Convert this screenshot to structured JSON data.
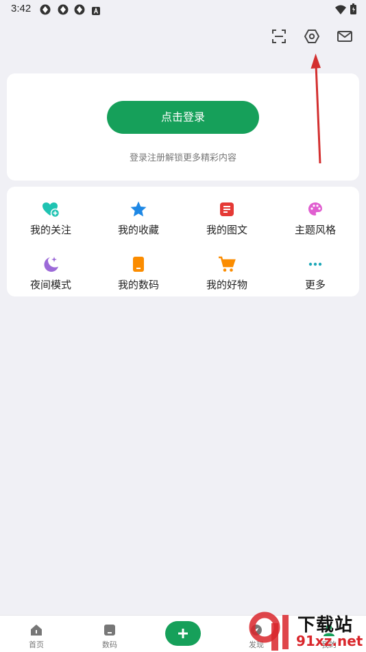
{
  "status": {
    "time": "3:42"
  },
  "login": {
    "button_label": "点击登录",
    "hint": "登录注册解锁更多精彩内容"
  },
  "grid": {
    "items": [
      {
        "label": "我的关注",
        "icon": "heart-plus-icon",
        "color": "#1fc3b2"
      },
      {
        "label": "我的收藏",
        "icon": "star-icon",
        "color": "#1e88e5"
      },
      {
        "label": "我的图文",
        "icon": "article-icon",
        "color": "#e53935"
      },
      {
        "label": "主题风格",
        "icon": "palette-icon",
        "color": "#e05fd0"
      },
      {
        "label": "夜间模式",
        "icon": "moon-icon",
        "color": "#9c6ad8"
      },
      {
        "label": "我的数码",
        "icon": "phone-icon",
        "color": "#fb8c00"
      },
      {
        "label": "我的好物",
        "icon": "cart-icon",
        "color": "#fb8c00"
      },
      {
        "label": "更多",
        "icon": "more-dots-icon",
        "color": "#1fa8b8"
      }
    ]
  },
  "tabbar": {
    "tabs": [
      {
        "label": "首页",
        "icon": "home-icon"
      },
      {
        "label": "数码",
        "icon": "device-icon"
      },
      {
        "label": "发现",
        "icon": "discover-icon"
      },
      {
        "label": "我的",
        "icon": "profile-icon"
      }
    ]
  },
  "watermark": {
    "text": "下载站",
    "domain": "91xz.net"
  },
  "colors": {
    "accent": "#16a05a",
    "background": "#f0f0f5",
    "arrow": "#d32f2f"
  }
}
